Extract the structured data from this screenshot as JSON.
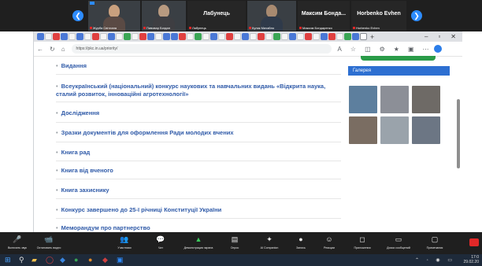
{
  "zoom": {
    "participants": [
      {
        "name": "Журба Світлана",
        "video": true
      },
      {
        "name": "Пивовар Богдан",
        "video": true
      },
      {
        "name": "Лабунець",
        "big_name": "Лабунець",
        "video": false
      },
      {
        "name": "Кулик Михайло",
        "video": true
      },
      {
        "name": "Максим Бондаренко",
        "big_name": "Максим Бонда...",
        "video": false
      },
      {
        "name": "Horbenko Evhen",
        "big_name": "Horbenko Evhen",
        "video": false
      }
    ],
    "controls": [
      {
        "icon": "🎤",
        "label": "Включить звук"
      },
      {
        "icon": "📹",
        "label": "Остановить видео"
      },
      {
        "icon": "👥",
        "label": "Участники"
      },
      {
        "icon": "💬",
        "label": "Чат"
      },
      {
        "icon": "▲",
        "label": "Демонстрация экрана"
      },
      {
        "icon": "▤",
        "label": "Опрос"
      },
      {
        "icon": "✦",
        "label": "AI Companion"
      },
      {
        "icon": "●",
        "label": "Запись"
      },
      {
        "icon": "☺",
        "label": "Реакции"
      },
      {
        "icon": "◻",
        "label": "Приложения"
      },
      {
        "icon": "▭",
        "label": "Доска сообщений"
      },
      {
        "icon": "▢",
        "label": "Примечания"
      }
    ]
  },
  "browser": {
    "url": "https://pkc.in.ua/priority/",
    "window_buttons": [
      "–",
      "▫",
      "✕"
    ]
  },
  "page": {
    "items": [
      {
        "text": "Видання"
      },
      {
        "text": "Всеукраїнський (національний) конкурс наукових та навчальних видань «Відкрита наука, сталий розвиток, інноваційні агротехнології»"
      },
      {
        "text": "Дослідження"
      },
      {
        "text": "Зразки документів для оформлення Ради молодих вчених"
      },
      {
        "text": "Книга рад"
      },
      {
        "text": "Книга від вченого"
      },
      {
        "text": "Книга захиснику"
      },
      {
        "text": "Конкурс завершено до 25-ї річниці Конституції України"
      },
      {
        "text": "Меморандум про партнерство"
      }
    ],
    "gallery_title": "Галерея",
    "thumb_colors": [
      "#5d7f9e",
      "#8c8f97",
      "#6e6a66",
      "#7a6d62",
      "#9aa3ab",
      "#6c7684"
    ]
  },
  "taskbar": {
    "time": "17:0",
    "date": "29.02.20"
  },
  "colors": {
    "link": "#2f5aa8",
    "gallery_header": "#2d6fd1",
    "zoom_bg": "#1f1f1f",
    "accent": "#2d8cff"
  }
}
